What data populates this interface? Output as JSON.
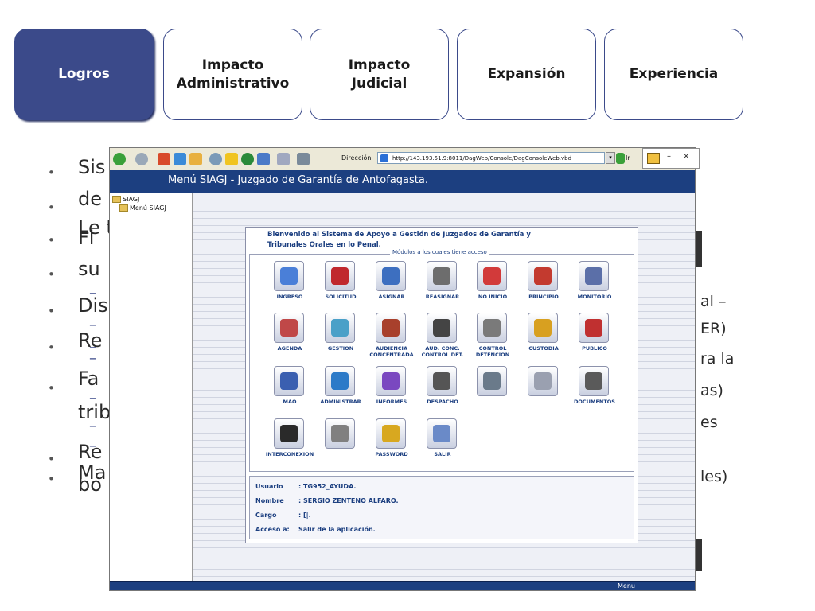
{
  "tabs": [
    {
      "label": "Logros"
    },
    {
      "label": "Impacto Administrativo"
    },
    {
      "label": "Impacto Judicial"
    },
    {
      "label": "Expansión"
    },
    {
      "label": "Experiencia"
    }
  ],
  "bullets_background": {
    "lines": [
      "Sis                                                                        asdas",
      "de                                                                            ones y",
      "Le                                                                               total",
      "Fl",
      "su",
      "Dis                                                                          as",
      "Re",
      "Fa",
      "trib",
      "Re",
      "Ma",
      "bo"
    ],
    "small_right": [
      "al –",
      "ER)",
      "ra la",
      "as)",
      "es",
      "les)"
    ]
  },
  "browser": {
    "address_label": "Dirección",
    "address_url": "http://143.193.51.9:8011/DagWeb/Console/DagConsoleWeb.vbd",
    "go_label": "Ir",
    "popup_controls": [
      "–",
      "×"
    ]
  },
  "app": {
    "title": "Menú SIAGJ - Juzgado de Garantía de Antofagasta.",
    "tree": [
      {
        "label": "SIAGJ"
      },
      {
        "label": "Menú SIAGJ"
      }
    ],
    "welcome": "Bienvenido al Sistema de Apoyo a Gestión de Juzgados de Garantía y Tribunales Orales en lo Penal.",
    "modules_caption": "Módulos a los cuales tiene acceso",
    "modules": [
      {
        "label": "INGRESO",
        "icon": "ingreso-icon",
        "color": "#4a7fd8"
      },
      {
        "label": "SOLICITUD",
        "icon": "solicitud-icon",
        "color": "#c0282d"
      },
      {
        "label": "ASIGNAR",
        "icon": "asignar-icon",
        "color": "#3d6fc0"
      },
      {
        "label": "REASIGNAR",
        "icon": "reasignar-icon",
        "color": "#6d6d6d"
      },
      {
        "label": "NO INICIO",
        "icon": "no-inicio-icon",
        "color": "#d23a3a"
      },
      {
        "label": "PRINCIPIO",
        "icon": "principio-icon",
        "color": "#c33a2f"
      },
      {
        "label": "MONITORIO",
        "icon": "monitorio-icon",
        "color": "#5b6fa8"
      },
      {
        "label": "AGENDA",
        "icon": "agenda-icon",
        "color": "#c04848"
      },
      {
        "label": "GESTION",
        "icon": "gestion-icon",
        "color": "#4aa0c8"
      },
      {
        "label": "AUDIENCIA CONCENTRADA",
        "icon": "audiencia-concentrada-icon",
        "color": "#a8402c"
      },
      {
        "label": "AUD. CONC. CONTROL DET.",
        "icon": "aud-conc-control-det-icon",
        "color": "#444444"
      },
      {
        "label": "CONTROL DETENCIÓN",
        "icon": "control-detencion-icon",
        "color": "#7a7a7a"
      },
      {
        "label": "CUSTODIA",
        "icon": "custodia-icon",
        "color": "#d8a020"
      },
      {
        "label": "PUBLICO",
        "icon": "publico-icon",
        "color": "#c03030"
      },
      {
        "label": "MAO",
        "icon": "mao-icon",
        "color": "#3a5fb0"
      },
      {
        "label": "ADMINISTRAR",
        "icon": "administrar-icon",
        "color": "#2c7ac8"
      },
      {
        "label": "INFORMES",
        "icon": "informes-icon",
        "color": "#7a48c0"
      },
      {
        "label": "DESPACHO",
        "icon": "despacho-icon",
        "color": "#555555"
      },
      {
        "label": "",
        "icon": "chart-icon",
        "color": "#6a7a8a"
      },
      {
        "label": "",
        "icon": "arrow-icon",
        "color": "#9aa0b0"
      },
      {
        "label": "DOCUMENTOS",
        "icon": "documentos-icon",
        "color": "#5a5a5a"
      },
      {
        "label": "INTERCONEXION",
        "icon": "interconexion-icon",
        "color": "#2a2a2a"
      },
      {
        "label": "",
        "icon": "tools-icon",
        "color": "#808080"
      },
      {
        "label": "PASSWORD",
        "icon": "password-icon",
        "color": "#d8a820"
      },
      {
        "label": "SALIR",
        "icon": "salir-icon",
        "color": "#6a8ac8"
      }
    ],
    "info": [
      {
        "key": "Usuario",
        "value": ":  TG952_AYUDA."
      },
      {
        "key": "Nombre",
        "value": ":  SERGIO ZENTENO ALFARO."
      },
      {
        "key": "Cargo",
        "value": ":  [|."
      },
      {
        "key": "Acceso  a:",
        "value": "Salir de la aplicación."
      }
    ],
    "status": "Menu"
  }
}
